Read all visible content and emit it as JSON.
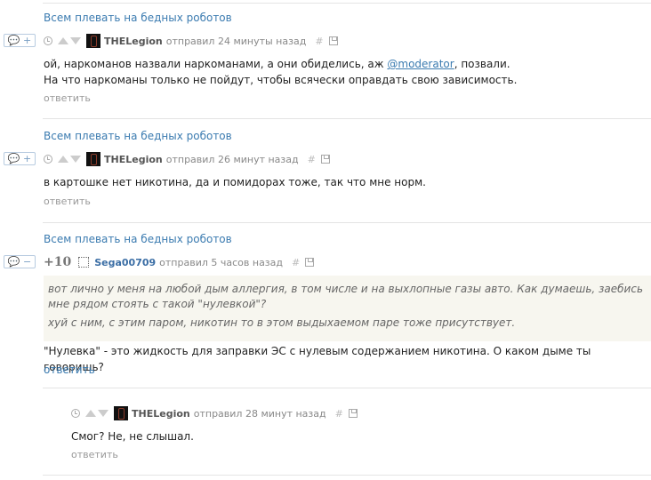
{
  "comments": [
    {
      "title": "Всем плевать на бедных роботов",
      "fold": "💬 +",
      "author": "THELegion",
      "action": "отправил 24 минуты назад",
      "text_before": "ой, наркоманов назвали наркоманами, а они обиделись, аж ",
      "mention": "@moderator",
      "text_after": ", позвали.",
      "line2": "На что наркоманы только не пойдут, чтобы всячески оправдать свою зависимость.",
      "reply": "ответить"
    },
    {
      "title": "Всем плевать на бедных роботов",
      "fold": "💬 +",
      "author": "THELegion",
      "action": "отправил 26 минут назад",
      "line1": " в картошке нет никотина, да и помидорах тоже, так что мне норм.",
      "reply": "ответить"
    },
    {
      "title": "Всем плевать на бедных роботов",
      "fold": "💬 −",
      "score": "+10",
      "author": "Sega00709",
      "action": "отправил 5 часов назад",
      "quote1": "вот лично у меня на любой дым аллергия, в том числе и на выхлопные газы авто. Как думаешь, заебись мне рядом стоять с такой \"нулевкой\"?",
      "quote2": "хуй с ним, с этим паром, никотин то в этом выдыхаемом паре тоже присутствует.",
      "line1": "\"Нулевка\" - это жидкость для заправки ЭС с нулевым содержанием никотина. О каком дыме ты говоришь?",
      "reply": "ответить"
    },
    {
      "author": "THELegion",
      "action": "отправил 28 минут назад",
      "line1": "Смог? Не, не слышал.",
      "reply": "ответить"
    }
  ],
  "icons": {
    "clock": "clock-icon",
    "vote_up": "arrow-up-icon",
    "vote_down": "arrow-down-icon",
    "hash": "#",
    "save": "floppy-icon"
  },
  "colors": {
    "link": "#3b7bb0",
    "quote_bg": "#f7f6ef",
    "separator": "#e4e4e4"
  }
}
